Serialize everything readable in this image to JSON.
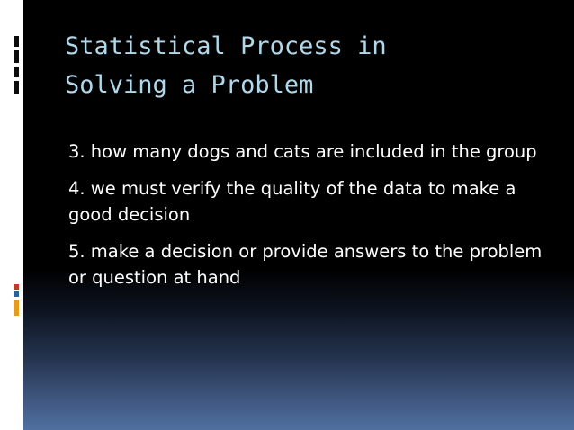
{
  "slide": {
    "title": "Statistical Process in\nSolving a Problem",
    "items": [
      {
        "text": "3. how many dogs and cats are included in the group"
      },
      {
        "text": "4. we must verify the quality of the data to make a good decision"
      },
      {
        "text": "5. make a decision or provide answers to the problem or question at hand"
      }
    ]
  },
  "colors": {
    "background": "#000000",
    "gradient_bottom": "#5070a0",
    "title": "#b0d8ea",
    "body_text": "#ffffff",
    "left_bar": "#ffffff",
    "accent_red": "#c0392b",
    "accent_blue": "#2e5f9e",
    "accent_orange": "#e89a1c"
  }
}
